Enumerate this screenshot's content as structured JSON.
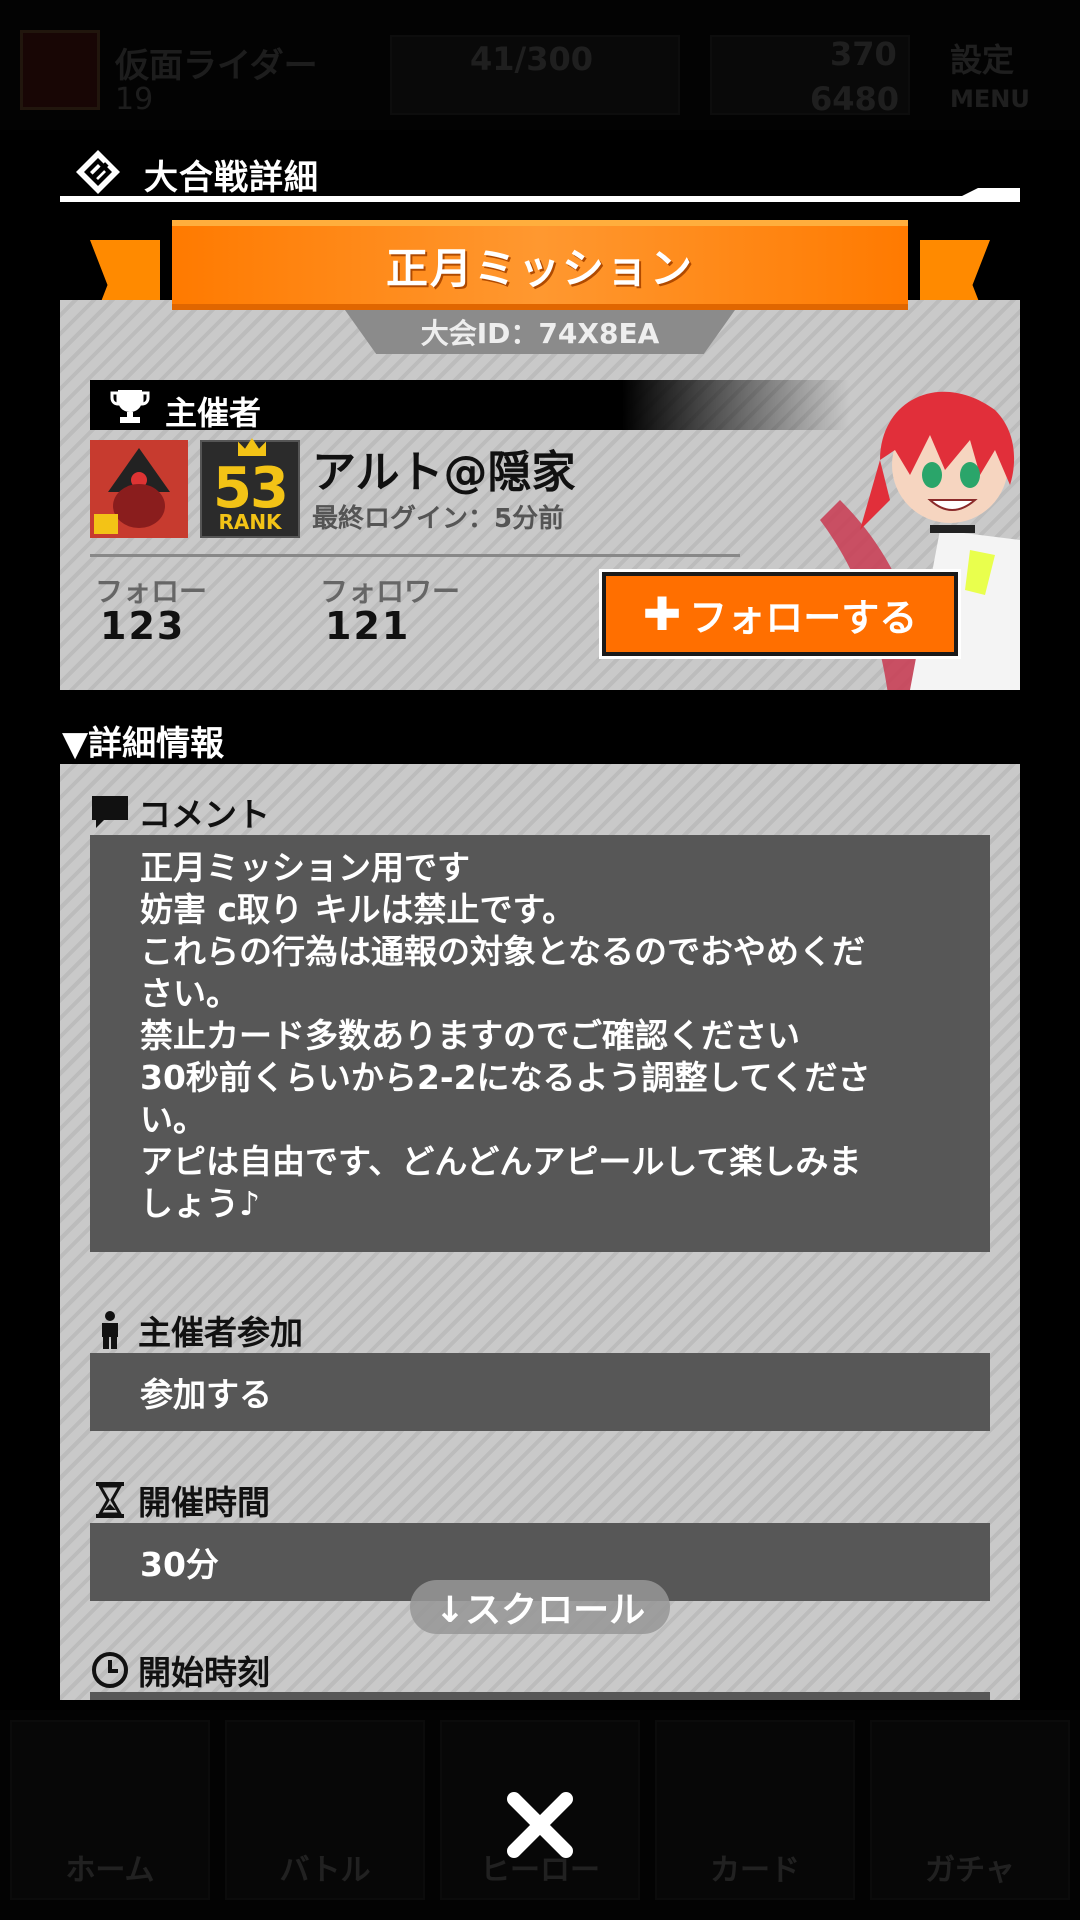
{
  "header": {
    "title": "大合戦詳細"
  },
  "tournament": {
    "name": "正月ミッション",
    "id_text": "大会ID：74X8EA"
  },
  "host": {
    "section_label": "主催者",
    "name": "アルト@隠家",
    "last_login": "最終ログイン：5分前",
    "rank_number": "53",
    "rank_word": "RANK",
    "follow_label": "フォロー",
    "follow_count": "123",
    "follower_label": "フォロワー",
    "follower_count": "121",
    "follow_button": "フォローする"
  },
  "details": {
    "section_title": "▼詳細情報",
    "comment_label": "コメント",
    "comment_lines": [
      "正月ミッション用です",
      "妨害 c取り キルは禁止です。",
      "これらの行為は通報の対象となるのでおやめくだ",
      "さい。",
      "禁止カード多数ありますのでご確認ください",
      "30秒前くらいから2-2になるよう調整してくださ",
      "い。",
      "アピは自由です、どんどんアピールして楽しみま",
      "しょう♪"
    ],
    "host_participation_label": "主催者参加",
    "host_participation_value": "参加する",
    "duration_label": "開催時間",
    "duration_value": "30分",
    "start_time_label": "開始時刻"
  },
  "scroll_hint": "↓スクロール",
  "background": {
    "player_name": "仮面ライダー",
    "level": "19",
    "stamina": "41/300",
    "currency1": "370",
    "currency2": "6480",
    "settings_label": "設定",
    "menu_label": "MENU",
    "tabs": [
      "ホーム",
      "バトル",
      "ヒーロー",
      "カード",
      "ガチャ"
    ]
  },
  "colors": {
    "accent_orange": "#ff7a00",
    "panel_gray": "#c9c9c9",
    "box_dark": "#575757"
  }
}
